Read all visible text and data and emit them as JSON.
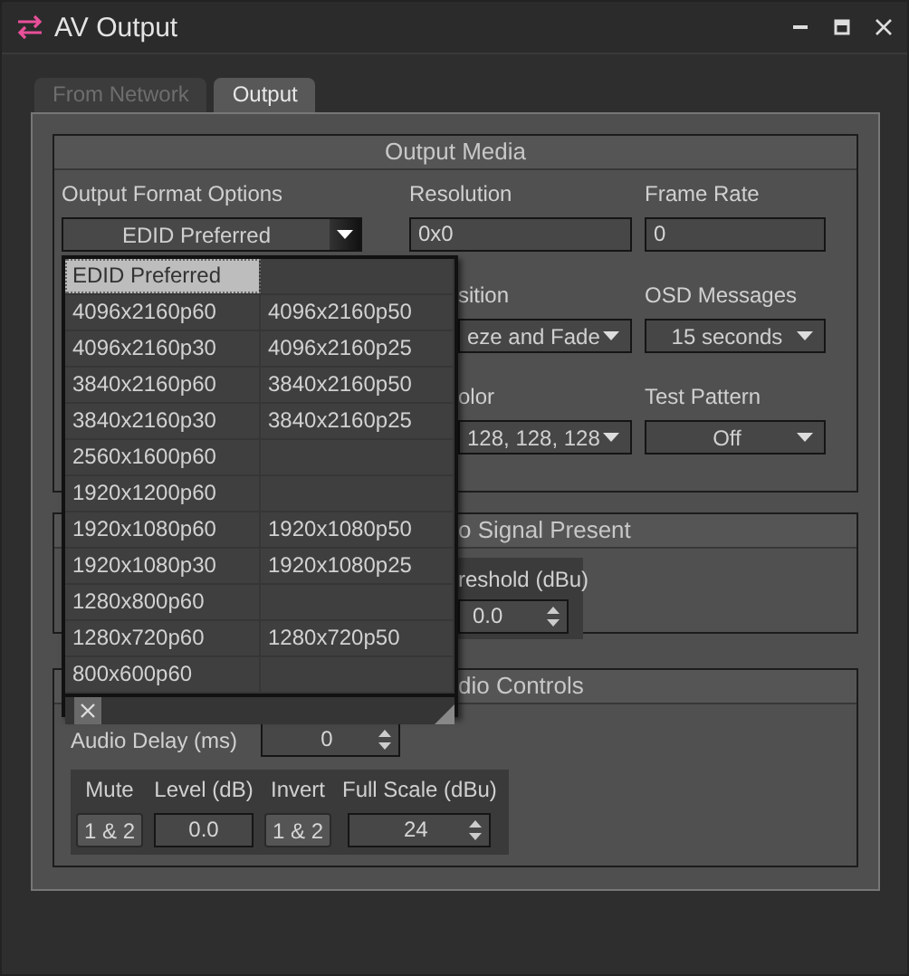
{
  "window": {
    "title": "AV Output"
  },
  "tabs": [
    {
      "label": "From Network",
      "selected": false
    },
    {
      "label": "Output",
      "selected": true
    }
  ],
  "output_media": {
    "title": "Output Media",
    "format": {
      "label": "Output Format Options",
      "value": "EDID Preferred"
    },
    "resolution": {
      "label": "Resolution",
      "value": "0x0"
    },
    "frame_rate": {
      "label": "Frame Rate",
      "value": "0"
    },
    "transition": {
      "label": "sition",
      "value": "eze and Fade"
    },
    "osd_messages": {
      "label": "OSD Messages",
      "value": "15 seconds"
    },
    "color": {
      "label": "olor",
      "value": "128, 128, 128"
    },
    "test_pattern": {
      "label": "Test Pattern",
      "value": "Off"
    }
  },
  "no_signal": {
    "title": "o Signal Present",
    "threshold": {
      "label": "reshold (dBu)",
      "value": "0.0"
    }
  },
  "audio": {
    "title": "dio Controls",
    "delay": {
      "label": "Audio Delay (ms)",
      "value": "0"
    },
    "columns": [
      {
        "kind": "button",
        "label": "Mute",
        "value": "1 & 2"
      },
      {
        "kind": "field",
        "label": "Level (dB)",
        "value": "0.0"
      },
      {
        "kind": "button",
        "label": "Invert",
        "value": "1 & 2"
      },
      {
        "kind": "spin",
        "label": "Full Scale (dBu)",
        "value": "24"
      }
    ]
  },
  "format_popup": {
    "rows": [
      {
        "options": [
          {
            "label": "EDID Preferred",
            "selected": true
          }
        ]
      },
      {
        "options": [
          {
            "label": "4096x2160p60",
            "selected": false
          },
          {
            "label": "4096x2160p50",
            "selected": false
          }
        ]
      },
      {
        "options": [
          {
            "label": "4096x2160p30",
            "selected": false
          },
          {
            "label": "4096x2160p25",
            "selected": false
          }
        ]
      },
      {
        "options": [
          {
            "label": "3840x2160p60",
            "selected": false
          },
          {
            "label": "3840x2160p50",
            "selected": false
          }
        ]
      },
      {
        "options": [
          {
            "label": "3840x2160p30",
            "selected": false
          },
          {
            "label": "3840x2160p25",
            "selected": false
          }
        ]
      },
      {
        "options": [
          {
            "label": "2560x1600p60",
            "selected": false
          }
        ]
      },
      {
        "options": [
          {
            "label": "1920x1200p60",
            "selected": false
          }
        ]
      },
      {
        "options": [
          {
            "label": "1920x1080p60",
            "selected": false
          },
          {
            "label": "1920x1080p50",
            "selected": false
          }
        ]
      },
      {
        "options": [
          {
            "label": "1920x1080p30",
            "selected": false
          },
          {
            "label": "1920x1080p25",
            "selected": false
          }
        ]
      },
      {
        "options": [
          {
            "label": "1280x800p60",
            "selected": false
          }
        ]
      },
      {
        "options": [
          {
            "label": "1280x720p60",
            "selected": false
          },
          {
            "label": "1280x720p50",
            "selected": false
          }
        ]
      },
      {
        "options": [
          {
            "label": "800x600p60",
            "selected": false
          }
        ]
      }
    ]
  }
}
